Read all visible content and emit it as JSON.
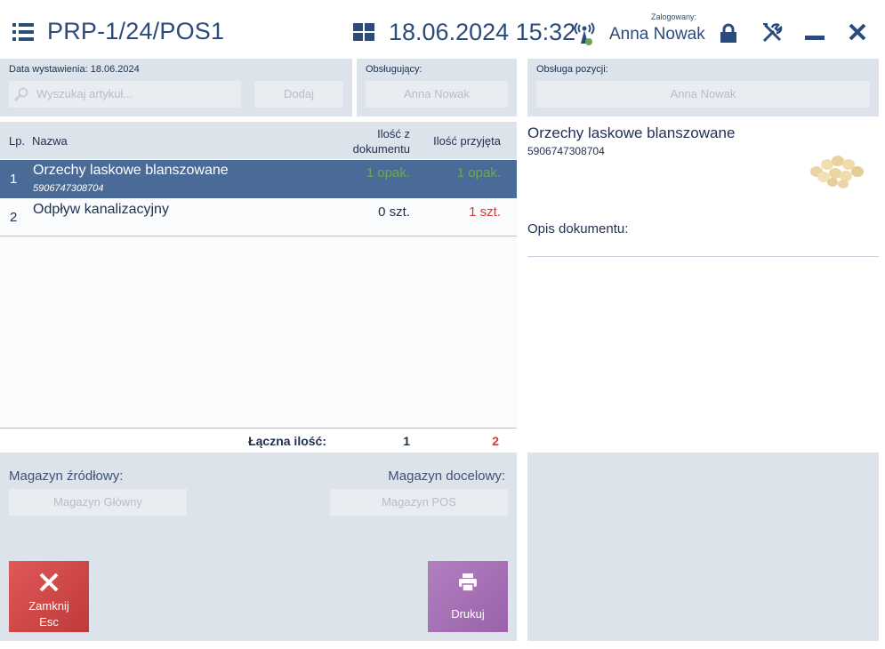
{
  "header": {
    "doc_number": "PRP-1/24/POS1",
    "datetime": "18.06.2024 15:32",
    "logged_label": "Zalogowany:",
    "user_name": "Anna Nowak"
  },
  "left_top": {
    "issue_date_label": "Data wystawienia: 18.06.2024",
    "search_placeholder": "Wyszukaj artykuł...",
    "add_button": "Dodaj"
  },
  "operator": {
    "label": "Obsługujący:",
    "value": "Anna Nowak"
  },
  "position_handler": {
    "label": "Obsługa pozycji:",
    "value": "Anna Nowak"
  },
  "table": {
    "columns": {
      "lp": "Lp.",
      "name": "Nazwa",
      "qty_doc_line1": "Ilość z",
      "qty_doc_line2": "dokumentu",
      "qty_received": "Ilość przyjęta"
    },
    "rows": [
      {
        "lp": "1",
        "name": "Orzechy laskowe blanszowane",
        "code": "5906747308704",
        "qty_doc": "1 opak.",
        "qty_received": "1 opak."
      },
      {
        "lp": "2",
        "name": "Odpływ kanalizacyjny",
        "code": "",
        "qty_doc": "0 szt.",
        "qty_received": "1 szt."
      }
    ],
    "total_label": "Łączna ilość:",
    "total_doc": "1",
    "total_received": "2"
  },
  "warehouses": {
    "source_label": "Magazyn źródłowy:",
    "source_value": "Magazyn Główny",
    "target_label": "Magazyn docelowy:",
    "target_value": "Magazyn POS"
  },
  "buttons": {
    "close_line1": "Zamknij",
    "close_line2": "Esc",
    "print": "Drukuj"
  },
  "details": {
    "product_name": "Orzechy laskowe blanszowane",
    "product_code": "5906747308704",
    "doc_desc_label": "Opis dokumentu:"
  },
  "colors": {
    "accent": "#2a4b7c",
    "selected_row": "#4a6b98",
    "qty_green": "#6aa84f",
    "qty_red": "#d03a3a",
    "close_button": "#d04848",
    "print_button": "#a86fb6"
  },
  "icons": [
    "menu-icon",
    "grid-icon",
    "signal-icon",
    "lock-icon",
    "tools-icon",
    "minimize-icon",
    "close-icon",
    "search-icon",
    "printer-icon",
    "x-icon"
  ]
}
